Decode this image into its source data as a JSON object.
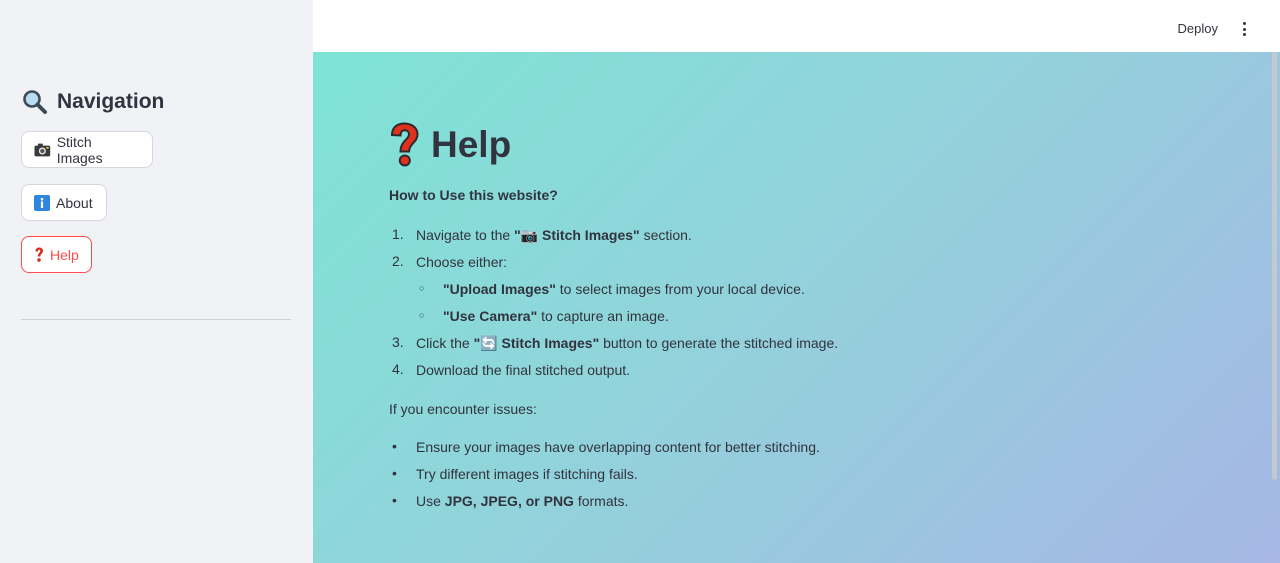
{
  "sidebar": {
    "title": "Navigation",
    "items": [
      {
        "label": "Stitch Images",
        "icon": "camera-icon"
      },
      {
        "label": "About",
        "icon": "info-icon"
      },
      {
        "label": "Help",
        "icon": "question-mark-icon",
        "active": true
      }
    ]
  },
  "header": {
    "deploy_label": "Deploy",
    "menu_icon": "kebab-menu-icon"
  },
  "main": {
    "title": "Help",
    "title_icon": "question-mark-icon",
    "subtitle": "How to Use this website?",
    "steps": [
      {
        "number": "1.",
        "prefix": "Navigate to the ",
        "bold": "\"📷 Stitch Images\"",
        "suffix": " section."
      },
      {
        "number": "2.",
        "text": "Choose either:"
      },
      {
        "bullet": "○",
        "bold": "\"Upload Images\"",
        "suffix": " to select images from your local device."
      },
      {
        "bullet": "○",
        "bold": "\"Use Camera\"",
        "suffix": " to capture an image."
      },
      {
        "number": "3.",
        "prefix": "Click the ",
        "bold": "\"🔄 Stitch Images\"",
        "suffix": " button to generate the stitched image."
      },
      {
        "number": "4.",
        "text": "Download the final stitched output."
      }
    ],
    "issues_heading": "If you encounter issues:",
    "issues": [
      {
        "text": "Ensure your images have overlapping content for better stitching."
      },
      {
        "text": "Try different images if stitching fails."
      },
      {
        "prefix": "Use ",
        "bold": "JPG, JPEG, or PNG",
        "suffix": " formats."
      }
    ]
  },
  "colors": {
    "accent": "#ff4b4b",
    "sidebar_bg": "#f0f2f6",
    "gradient_start": "#7ee3d6",
    "gradient_end": "#a6b6e5",
    "text": "#31333f"
  }
}
